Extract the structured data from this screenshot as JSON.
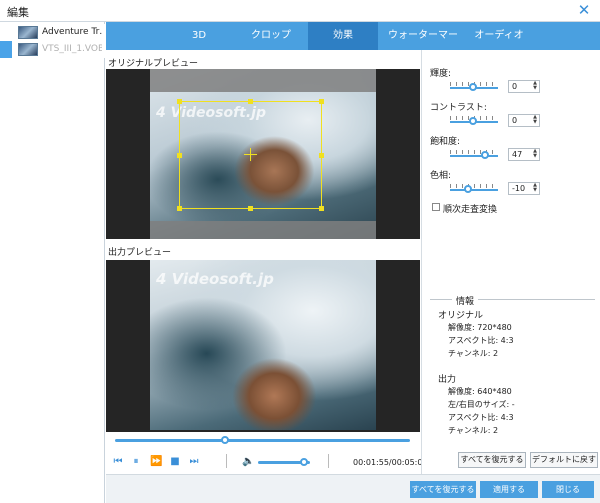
{
  "window": {
    "title": "編集",
    "close_icon": "✕"
  },
  "files": [
    {
      "name": "Adventure Tr…"
    },
    {
      "name": "VTS_III_1.VOB"
    }
  ],
  "tabs": [
    "3D",
    "クロップ",
    "効果",
    "ウォーターマーク",
    "オーディオ"
  ],
  "active_tab": "効果",
  "preview": {
    "original_label": "オリジナルプレビュー",
    "output_label": "出力プレビュー",
    "watermark_text": "4 Videosoft.jp"
  },
  "player": {
    "seek_fraction": 0.38,
    "volume_fraction": 0.92,
    "time": "00:01:55/00:05:07"
  },
  "adjustments": {
    "brightness": {
      "label": "輝度:",
      "value": "0"
    },
    "contrast": {
      "label": "コントラスト:",
      "value": "0"
    },
    "saturation": {
      "label": "飽和度:",
      "value": "47"
    },
    "hue": {
      "label": "色相:",
      "value": "-10"
    },
    "deinterlace_label": "順次走査変換"
  },
  "info": {
    "heading": "情報",
    "original": {
      "title": "オリジナル",
      "resolution": "解像度: 720*480",
      "aspect": "アスペクト比: 4:3",
      "channel": "チャンネル: 2"
    },
    "output": {
      "title": "出力",
      "resolution": "解像度: 640*480",
      "border": "左/右目のサイズ: -",
      "aspect": "アスペクト比: 4:3",
      "channel": "チャンネル: 2"
    }
  },
  "right_buttons": {
    "restore_all": "すべてを復元する",
    "restore_default": "デフォルトに戻す"
  },
  "footer_buttons": {
    "restore_all": "すべてを復元する",
    "apply": "適用する",
    "close": "閉じる"
  }
}
